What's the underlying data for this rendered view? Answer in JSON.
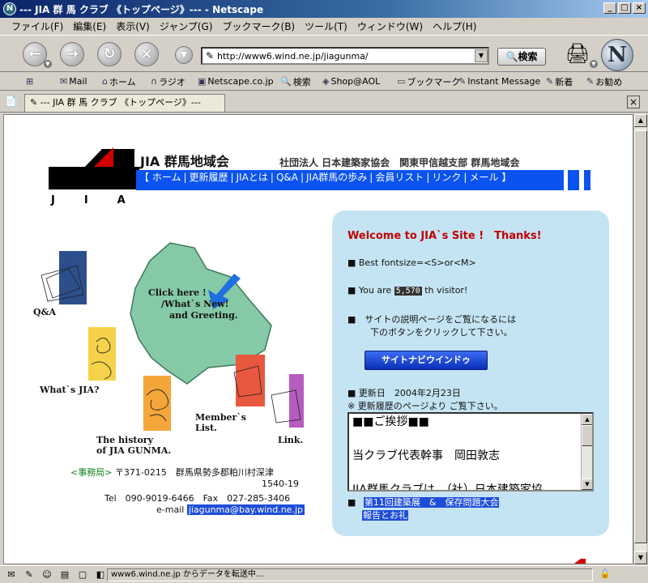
{
  "window": {
    "title": "--- JIA 群 馬 クラブ 《トップページ》--- - Netscape",
    "buttons": {
      "minimize": "_",
      "maximize": "□",
      "close": "×"
    }
  },
  "menu": [
    "ファイル(F)",
    "編集(E)",
    "表示(V)",
    "ジャンプ(G)",
    "ブックマーク(B)",
    "ツール(T)",
    "ウィンドウ(W)",
    "ヘルプ(H)"
  ],
  "toolbar": {
    "url": "http://www6.wind.ne.jp/jiagunma/",
    "search_label": "検索"
  },
  "personal_toolbar": [
    "Mail",
    "ホーム",
    "ラジオ",
    "Netscape.co.jp",
    "検索",
    "Shop@AOL",
    "ブックマーク",
    "Instant Message",
    "新着",
    "お勧め"
  ],
  "tab": {
    "title": "--- JIA 群 馬 クラブ 《トップページ》---"
  },
  "header": {
    "logo_letters": "JIA",
    "title": "JIA 群馬地域会",
    "subtitle": "社団法人 日本建築家協会　関東甲信越支部 群馬地域会",
    "nav_open": "【",
    "nav_close": "】",
    "nav_items": [
      "ホーム",
      "更新履歴",
      "JIAとは",
      "Q&A",
      "JIA群馬の歩み",
      "会員リスト",
      "リンク",
      "メール"
    ]
  },
  "illustration": {
    "map_text_1": "Click here !",
    "map_text_2": "/What`s New!",
    "map_text_3": "and Greeting.",
    "qa": "Q&A",
    "whats_jia": "What`s JIA?",
    "history_1": "The history",
    "history_2": "of JIA GUNMA.",
    "members_1": "Member`s",
    "members_2": "List.",
    "link": "Link."
  },
  "office": {
    "label": "<事務局>",
    "address": "〒371-0215　群馬県勢多郡粕川村深津",
    "address2": "1540-19",
    "tel": "Tel　090-9019-6466　Fax　027-285-3406",
    "email_label": "e-mail",
    "email": "jiagunma@bay.wind.ne.jp"
  },
  "panel": {
    "welcome": "Welcome to JIA`s Site !　Thanks!",
    "fontsize": "■ Best fontsize=<S>or<M>",
    "visitor_pre": "■ You are ",
    "visitor_count": "5,570",
    "visitor_post": " th visitor!",
    "explain_1": "■　サイトの説明ページをご覧になるには",
    "explain_2": "下のボタンをクリックして下さい。",
    "navi_button": "サイトナビウインドゥ",
    "updated": "■ 更新日　2004年2月23日",
    "updated_note": "※ 更新履歴のページより ご覧下さい。",
    "greeting_lines": [
      "■■ご挨拶■■",
      "",
      "当クラブ代表幹事　岡田敦志",
      "",
      "JIA群馬クラブは、（社）日本建築家協"
    ],
    "link_bullet": "■",
    "link_line1": "第11回建築展　&　保存問題大会",
    "link_line2": "報告とお礼"
  },
  "status": {
    "text": "www6.wind.ne.jp からデータを転送中..."
  },
  "colors": {
    "nav_blue": "#0a53f0",
    "panel_bg": "#c5e4f3",
    "welcome_red": "#c00000",
    "map_green": "#86c9a6"
  }
}
